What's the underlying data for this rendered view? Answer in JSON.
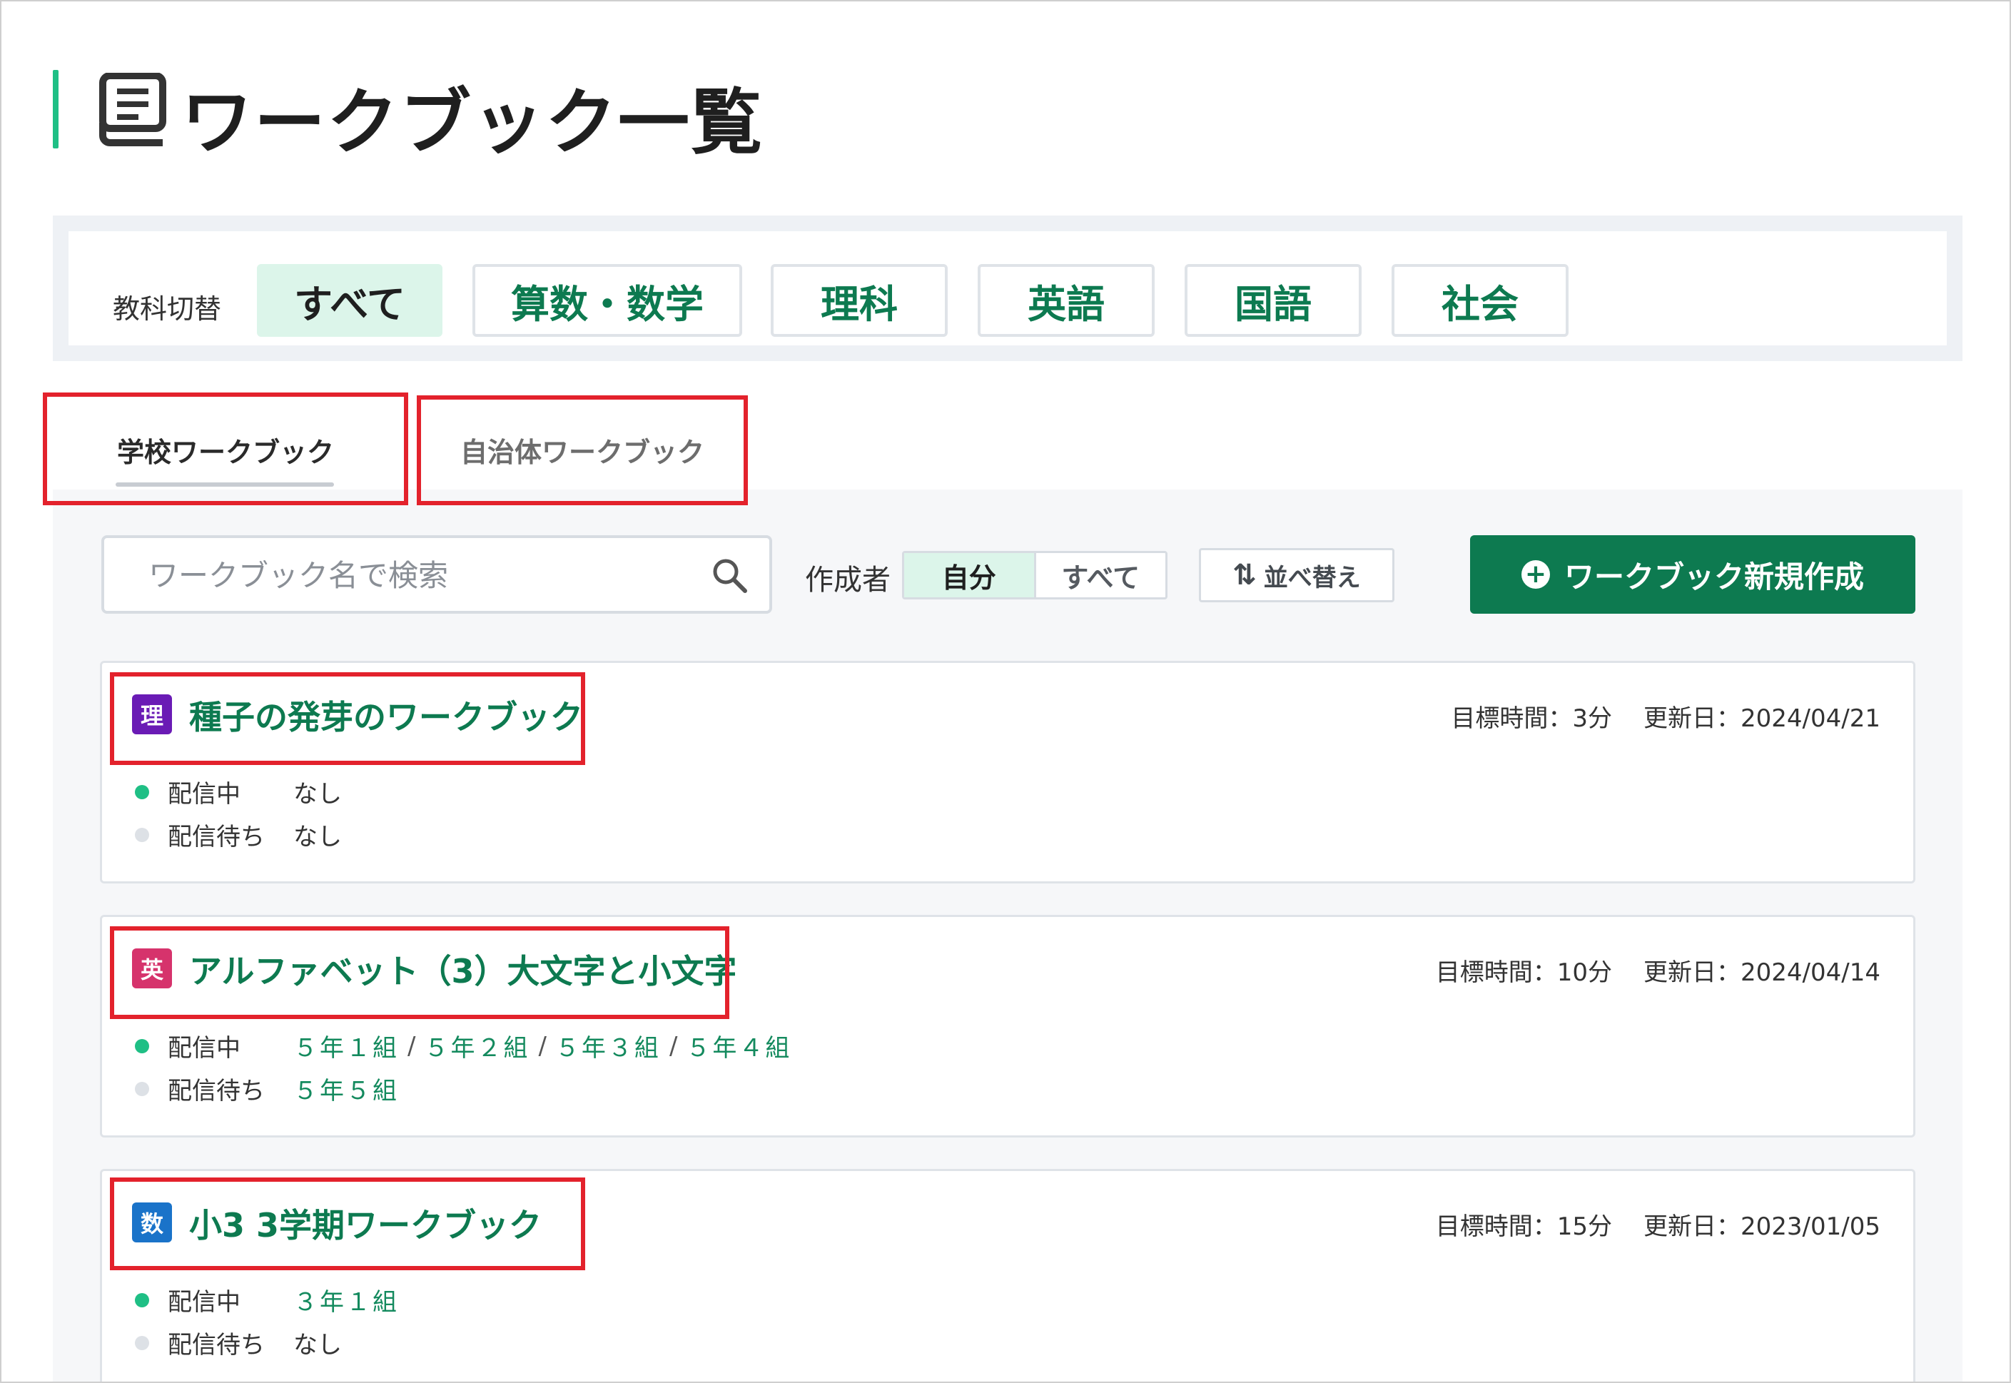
{
  "page": {
    "title": "ワークブック一覧",
    "title_icon": "book-icon"
  },
  "subject_switch": {
    "label": "教科切替",
    "options": [
      "すべて",
      "算数・数学",
      "理科",
      "英語",
      "国語",
      "社会"
    ],
    "selected": "すべて"
  },
  "tabs": [
    {
      "label": "学校ワークブック",
      "active": true
    },
    {
      "label": "自治体ワークブック",
      "active": false
    }
  ],
  "toolbar": {
    "search_placeholder": "ワークブック名で検索",
    "search_icon": "search-icon",
    "creator_label": "作成者",
    "creator_options": [
      "自分",
      "すべて"
    ],
    "creator_selected": "自分",
    "sort_label": "並べ替え",
    "sort_icon": "sort-icon",
    "new_button": "ワークブック新規作成",
    "new_icon": "plus-circle-icon"
  },
  "colors": {
    "accent": "#0d7a50",
    "accent_light": "#dcf5ea",
    "title_bar": "#1fbf85",
    "highlight": "#e3222c"
  },
  "workbooks": [
    {
      "subject_badge": "理",
      "badge_color": "#6a1bb5",
      "title": "種子の発芽のワークブック",
      "target_time": "目標時間：3分",
      "updated": "更新日：2024/04/21",
      "live_label": "配信中",
      "live_value": "なし",
      "wait_label": "配信待ち",
      "wait_value": "なし"
    },
    {
      "subject_badge": "英",
      "badge_color": "#d6336c",
      "title": "アルファベット（3）大文字と小文字",
      "target_time": "目標時間：10分",
      "updated": "更新日：2024/04/14",
      "live_label": "配信中",
      "live_classes": [
        "５年１組",
        "５年２組",
        "５年３組",
        "５年４組"
      ],
      "wait_label": "配信待ち",
      "wait_classes": [
        "５年５組"
      ]
    },
    {
      "subject_badge": "数",
      "badge_color": "#1a73c9",
      "title": "小3 3学期ワークブック",
      "target_time": "目標時間：15分",
      "updated": "更新日：2023/01/05",
      "live_label": "配信中",
      "live_classes": [
        "３年１組"
      ],
      "wait_label": "配信待ち",
      "wait_value": "なし"
    }
  ]
}
